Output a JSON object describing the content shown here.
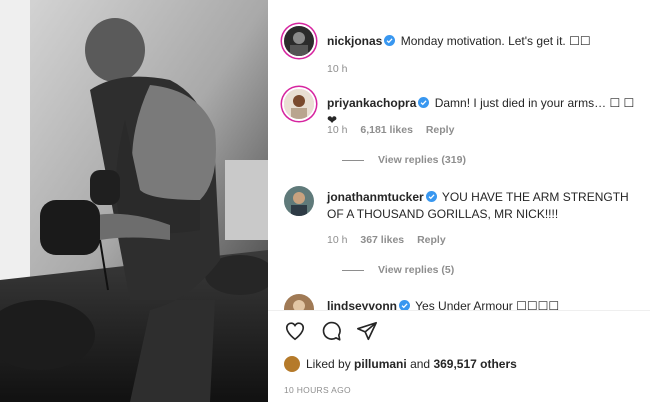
{
  "post": {
    "author": "nickjonas",
    "caption": "Monday motivation. Let's get it. ☐☐",
    "time": "10 h"
  },
  "comments": [
    {
      "username": "priyankachopra",
      "text": "Damn! I just died in your arms… ☐ ☐ ❤",
      "time": "10 h",
      "likes": "6,181 likes",
      "reply": "Reply",
      "view_replies": "View replies (319)"
    },
    {
      "username": "jonathanmtucker",
      "text": "YOU HAVE THE ARM STRENGTH OF A THOUSAND GORILLAS, MR NICK!!!!",
      "time": "10 h",
      "likes": "367 likes",
      "reply": "Reply",
      "view_replies": "View replies (5)"
    },
    {
      "username": "lindseyvonn",
      "text": "Yes Under Armour ☐☐☐☐"
    }
  ],
  "liked_by": {
    "prefix": "Liked by",
    "user": "pillumani",
    "middle": "and",
    "count": "369,517 others"
  },
  "timestamp": "10 HOURS AGO",
  "colors": {
    "verified": "#3897f0",
    "muted": "#8e8e8e",
    "text": "#262626"
  }
}
